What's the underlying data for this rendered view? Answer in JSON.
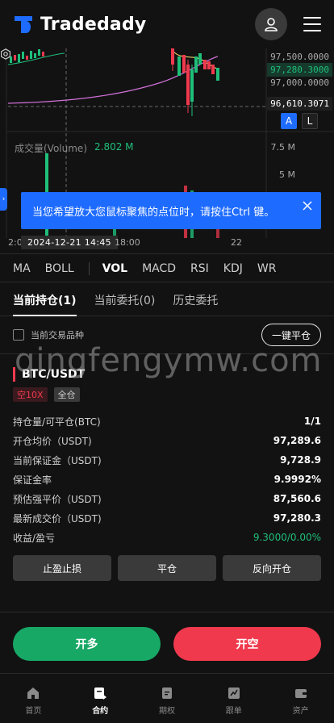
{
  "app": {
    "brand": "Tradedady"
  },
  "chart": {
    "price_labels": [
      "97,500.0000",
      "97,000.0000"
    ],
    "current_price": "97,280.3000",
    "ref_price": "96,610.3071",
    "al_a": "A",
    "al_l": "L",
    "volume_title": "成交量(Volume)",
    "volume_value": "2.802 M",
    "volume_axis": [
      "7.5 M",
      "5 M"
    ],
    "date_bubble": "2024-12-21   14:45",
    "time_ticks": [
      "2:0",
      "18:00",
      "22"
    ],
    "colors": {
      "up": "#1fbf7a",
      "down": "#f0394d",
      "ma1": "#e6d06a",
      "ma2": "#d070d8"
    }
  },
  "toast": {
    "message": "当您希望放大您鼠标聚焦的点位时，请按住Ctrl 键。"
  },
  "indicators": {
    "main": [
      "MA",
      "BOLL"
    ],
    "sub": [
      "VOL",
      "MACD",
      "RSI",
      "KDJ",
      "WR"
    ],
    "active": "VOL"
  },
  "position_tabs": [
    "当前持仓(1)",
    "当前委托(0)",
    "历史委托"
  ],
  "filter": {
    "label": "当前交易品种",
    "close_all": "一键平仓"
  },
  "watermark": "qingfengymw.com",
  "position": {
    "symbol": "BTC/USDT",
    "tag_side": "空10X",
    "tag_mode": "全仓",
    "rows": [
      {
        "k": "持仓量/可平仓(BTC)",
        "v": "1/1"
      },
      {
        "k": "开仓均价（USDT)",
        "v": "97,289.6"
      },
      {
        "k": "当前保证金（USDT)",
        "v": "9,728.9"
      },
      {
        "k": "保证金率",
        "v": "9.9992%"
      },
      {
        "k": "预估强平价（USDT)",
        "v": "87,560.6"
      },
      {
        "k": "最新成交价（USDT)",
        "v": "97,280.3"
      },
      {
        "k": "收益/盈亏",
        "v": "9.3000/0.00%"
      }
    ],
    "actions": [
      "止盈止损",
      "平仓",
      "反向开仓"
    ]
  },
  "trade": {
    "long": "开多",
    "short": "开空"
  },
  "nav": [
    "首页",
    "合约",
    "期权",
    "跟单",
    "资产"
  ]
}
